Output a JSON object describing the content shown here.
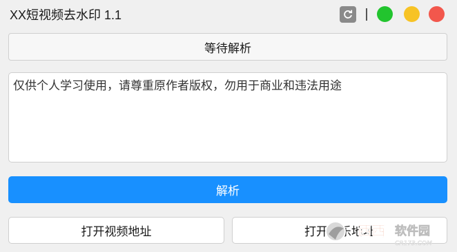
{
  "window": {
    "title": "XX短视频去水印 1.1",
    "controls": {
      "refresh_icon": "refresh-icon",
      "green": "#22c42e",
      "yellow": "#f7c325",
      "red": "#f2574c"
    }
  },
  "status": {
    "label": "等待解析"
  },
  "notice": {
    "text": "仅供个人学习使用，请尊重原作者版权，勿用于商业和违法用途"
  },
  "actions": {
    "parse_label": "解析",
    "open_video_label": "打开视频地址",
    "open_music_label": "打开音乐地址"
  },
  "watermark": {
    "brand": "西西软件园",
    "site": "CR173.COM"
  },
  "colors": {
    "accent": "#1890ff",
    "background": "#f0f0f0"
  }
}
